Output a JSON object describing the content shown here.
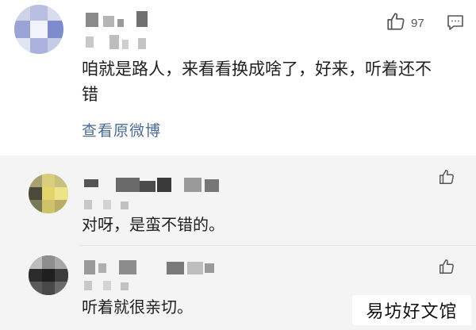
{
  "main_comment": {
    "text_line1": "咱就是路人，来看看换成啥了，好来，听着还不",
    "text_line2": "错",
    "view_original": "查看原微博",
    "like_count": "97",
    "icons": {
      "like": "thumbs-up-icon",
      "comment": "comment-icon"
    }
  },
  "replies": [
    {
      "text": "对呀，是蛮不错的。",
      "icon": "thumbs-up-icon"
    },
    {
      "text": "听着就很亲切。",
      "icon": "thumbs-up-icon"
    }
  ],
  "watermark": {
    "text": "易坊好文馆"
  },
  "colors": {
    "link": "#4b6b94",
    "reply_bg": "#f4f4f4",
    "text": "#1f1f1f"
  }
}
